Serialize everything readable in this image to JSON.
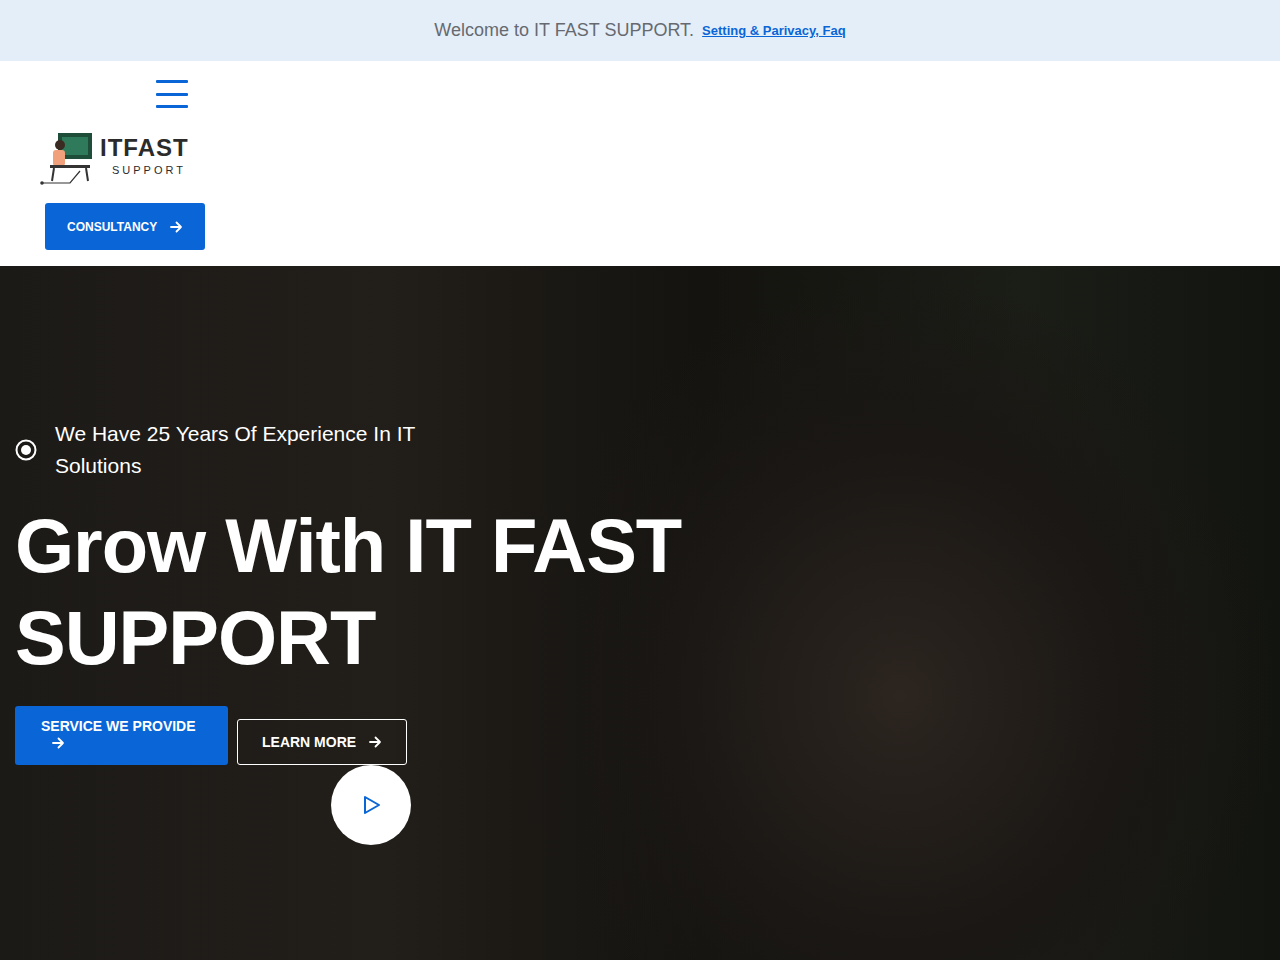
{
  "top_bar": {
    "welcome": "Welcome to IT FAST SUPPORT.",
    "link": "Setting & Parivacy, Faq"
  },
  "header": {
    "logo": {
      "title": "ITFAST",
      "subtitle": "SUPPORT"
    },
    "consultancy_button": "CONSULTANCY"
  },
  "hero": {
    "tagline": "We Have 25 Years Of Experience In IT Solutions",
    "heading": "Grow With IT FAST SUPPORT",
    "buttons": [
      {
        "label": "SERVICE WE PROVIDE",
        "kind": "primary"
      },
      {
        "label": "LEARN MORE",
        "kind": "outline"
      }
    ]
  }
}
